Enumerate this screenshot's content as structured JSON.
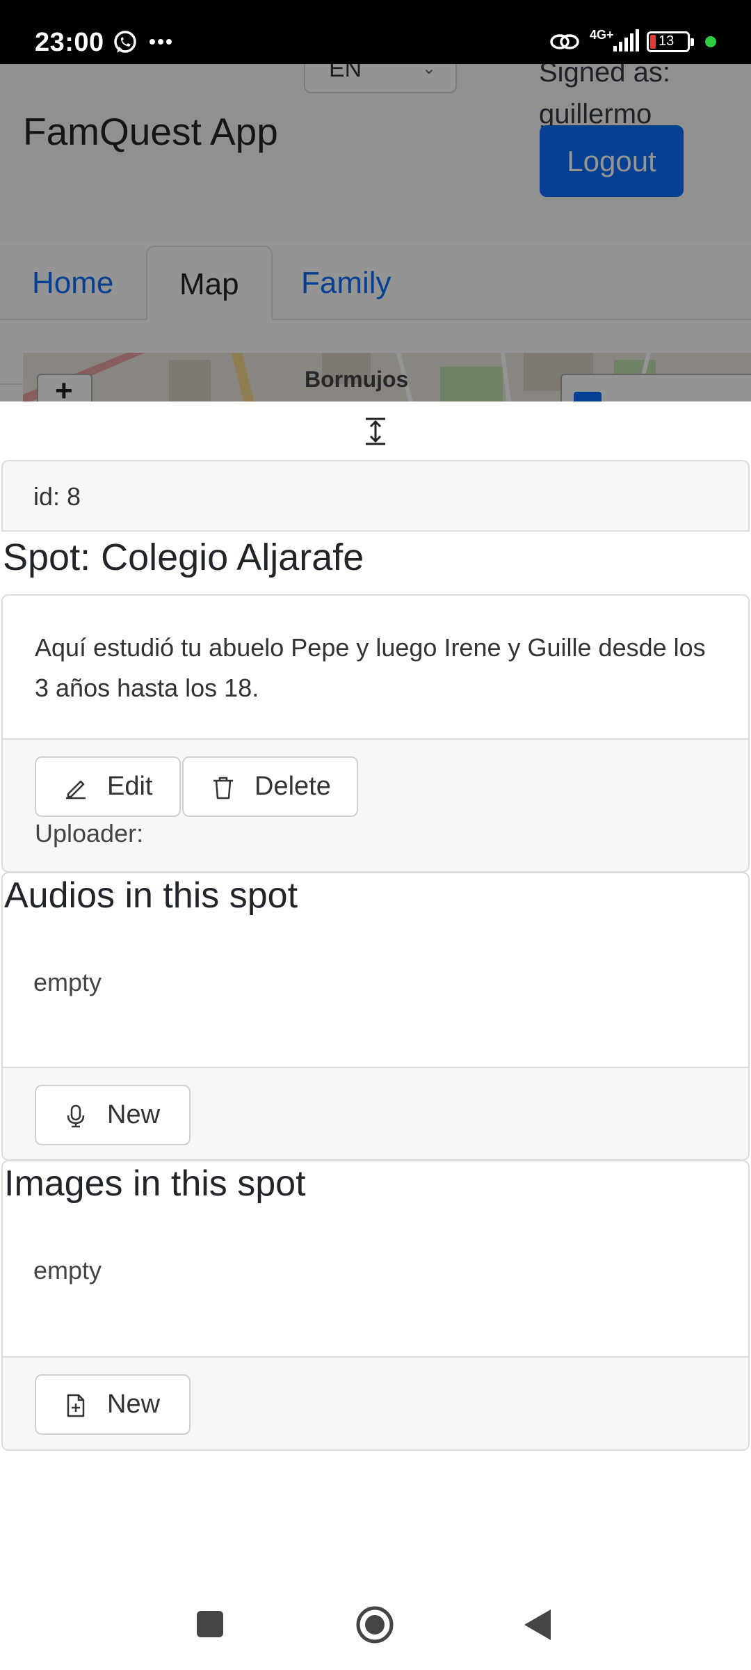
{
  "status_bar": {
    "time": "23:00",
    "network": "4G+",
    "battery": "13"
  },
  "header": {
    "app_title": "FamQuest App",
    "language": "EN",
    "signed_as_label": "Signed as:",
    "username": "guillermo",
    "logout_label": "Logout"
  },
  "tabs": [
    {
      "label": "Home",
      "active": false
    },
    {
      "label": "Map",
      "active": true
    },
    {
      "label": "Family",
      "active": false
    }
  ],
  "map": {
    "place_label": "Bormujos",
    "zoom_in": "+"
  },
  "spot": {
    "id_text": "id: 8",
    "title": "Spot: Colegio Aljarafe",
    "description": "Aquí estudió tu abuelo Pepe y luego Irene y Guille desde los 3 años hasta los 18.",
    "edit_label": "Edit",
    "delete_label": "Delete",
    "uploader_label": "Uploader:"
  },
  "audios": {
    "title": "Audios in this spot",
    "empty_text": "empty",
    "new_label": "New"
  },
  "images": {
    "title": "Images in this spot",
    "empty_text": "empty",
    "new_label": "New"
  },
  "colors": {
    "primary": "#0d6efd",
    "border": "#dcdcdc",
    "footer_bg": "#f7f7f7"
  }
}
